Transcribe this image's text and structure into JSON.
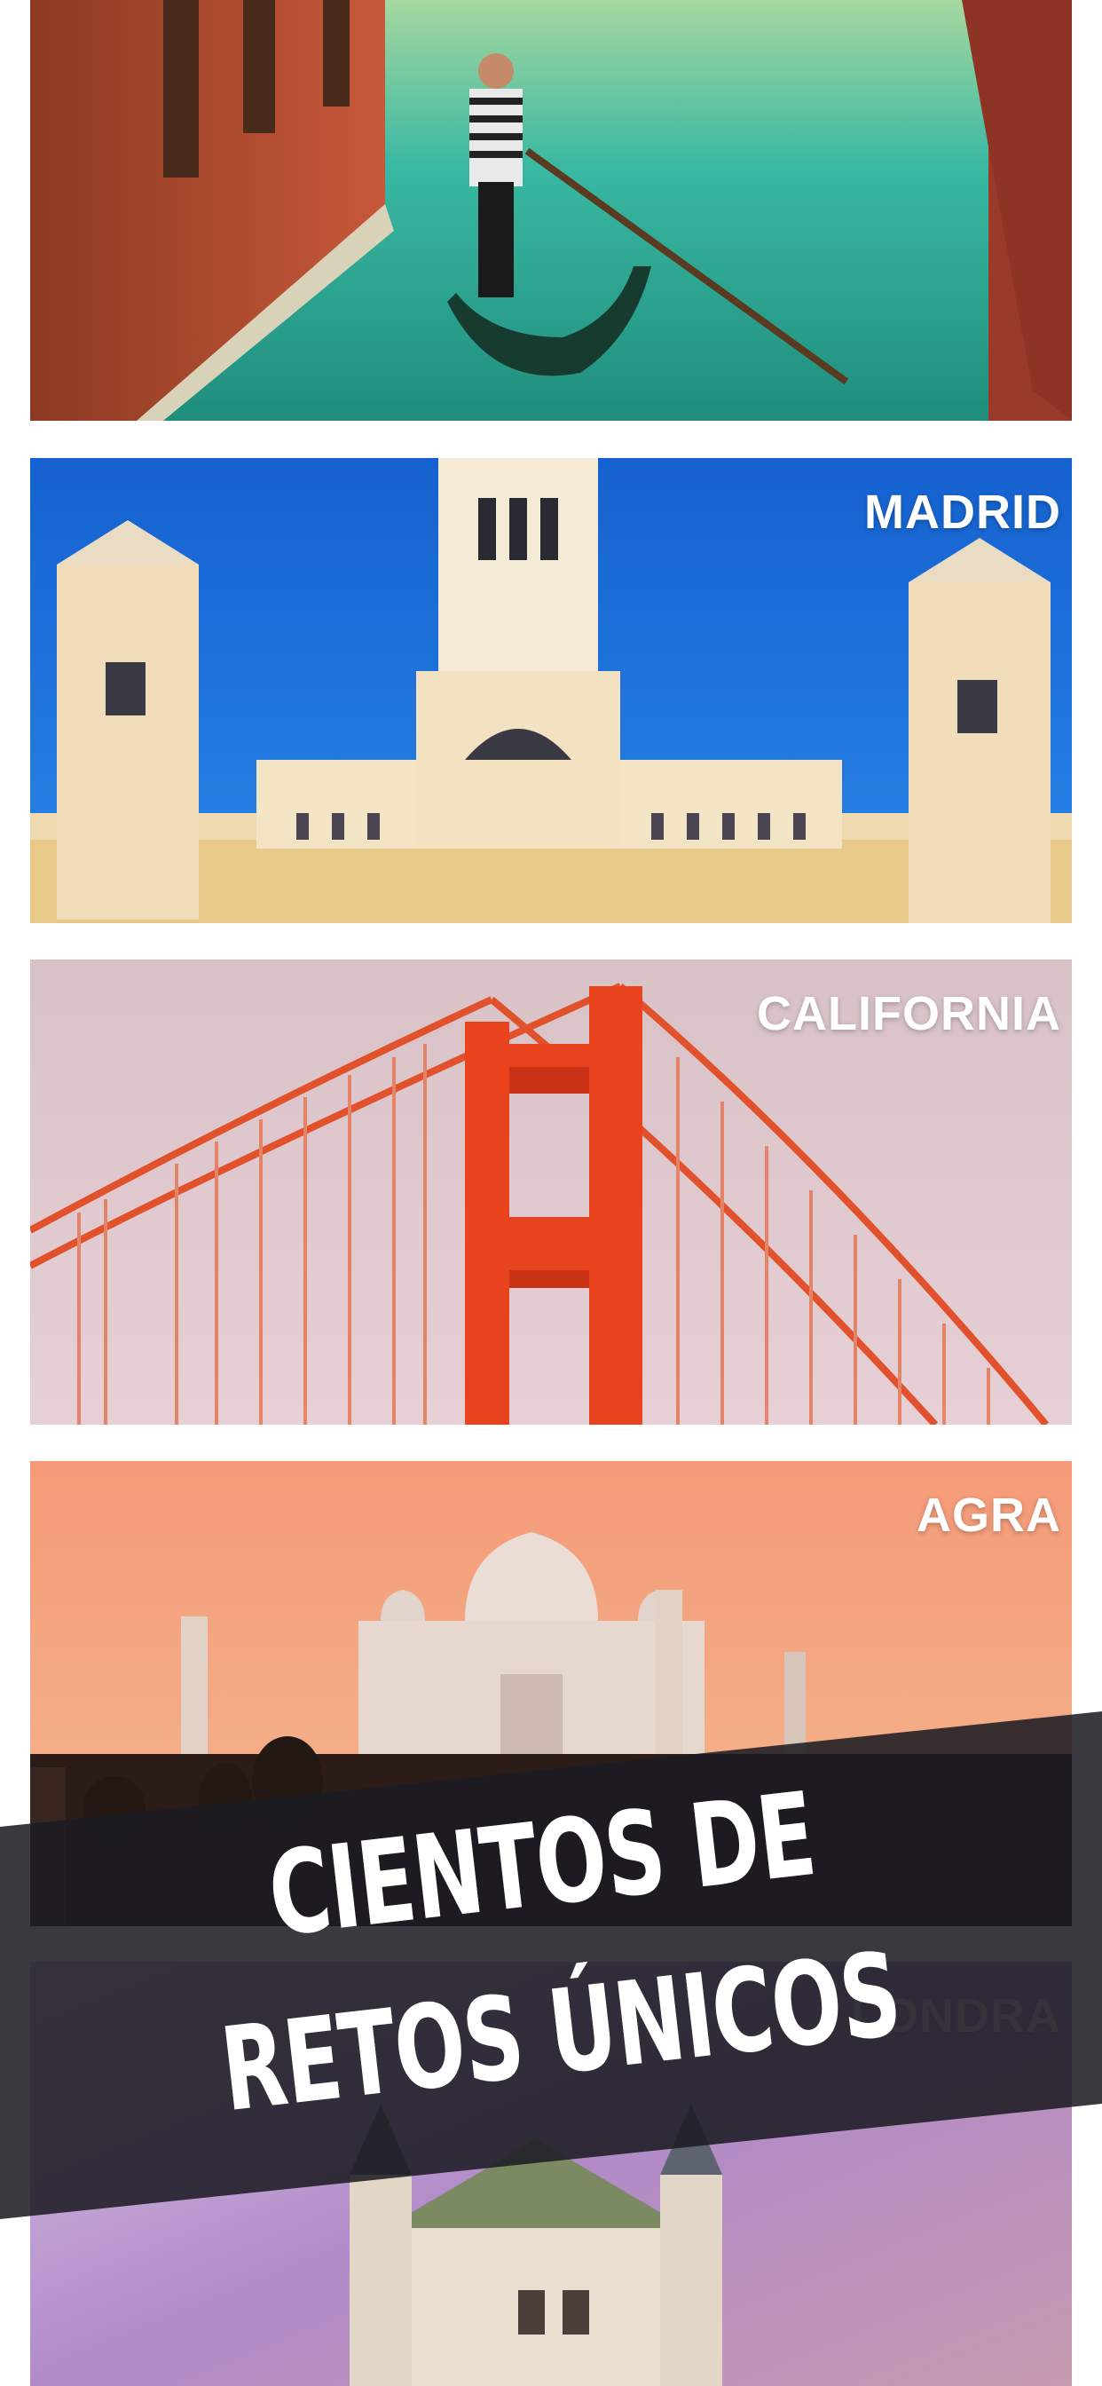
{
  "cities": [
    {
      "id": "venice",
      "label": ""
    },
    {
      "id": "madrid",
      "label": "MADRID"
    },
    {
      "id": "california",
      "label": "CALIFORNIA"
    },
    {
      "id": "agra",
      "label": "AGRA"
    },
    {
      "id": "london",
      "label": "LONDRA"
    }
  ],
  "banner": {
    "line1": "CIENTOS DE",
    "line2": "RETOS ÚNICOS",
    "background_color": "#1c1c22"
  },
  "colors": {
    "madrid_sky": "#1f6fd6",
    "california_bridge": "#e8401c",
    "california_sky": "#d9c2c8",
    "agra_sky": "#f4a27a",
    "london_sky": "#b58ac8",
    "venice_water": "#2fb3a0"
  }
}
